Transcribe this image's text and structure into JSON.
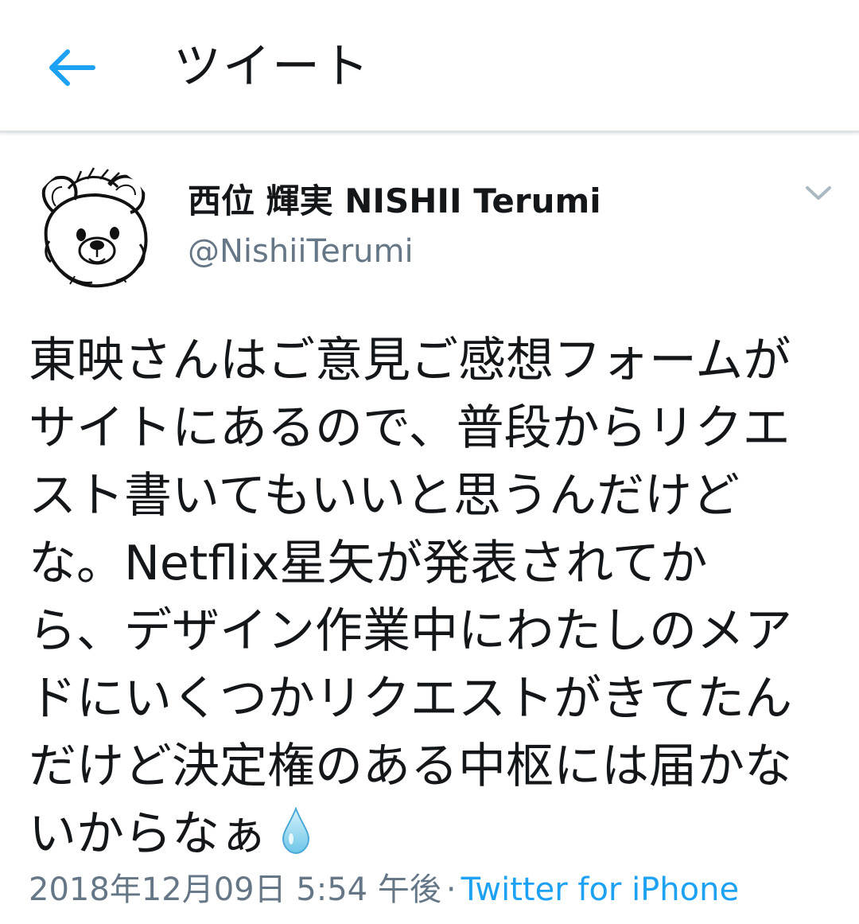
{
  "header": {
    "title": "ツイート",
    "back_icon": "arrow-left-icon",
    "accent_color": "#1da1f2"
  },
  "tweet": {
    "display_name": "西位 輝実 NISHII Terumi",
    "handle": "@NishiiTerumi",
    "avatar_icon": "avatar-bear-sketch",
    "menu_icon": "chevron-down-icon",
    "text_lines": [
      "東映さんはご意見ご感想フォームが",
      "サイトにあるので、普段からリクエ",
      "スト書いてもいいと思うんだけど",
      "な。Netflix星矢が発表されてか",
      "ら、デザイン作業中にわたしのメア",
      "ドにいくつかリクエストがきてたん",
      "だけど決定権のある中枢には届かな",
      "いからなぁ"
    ],
    "emoji": "droplet-icon",
    "timestamp": "2018年12月09日 5:54 午後",
    "separator": "·",
    "source": "Twitter for iPhone"
  }
}
